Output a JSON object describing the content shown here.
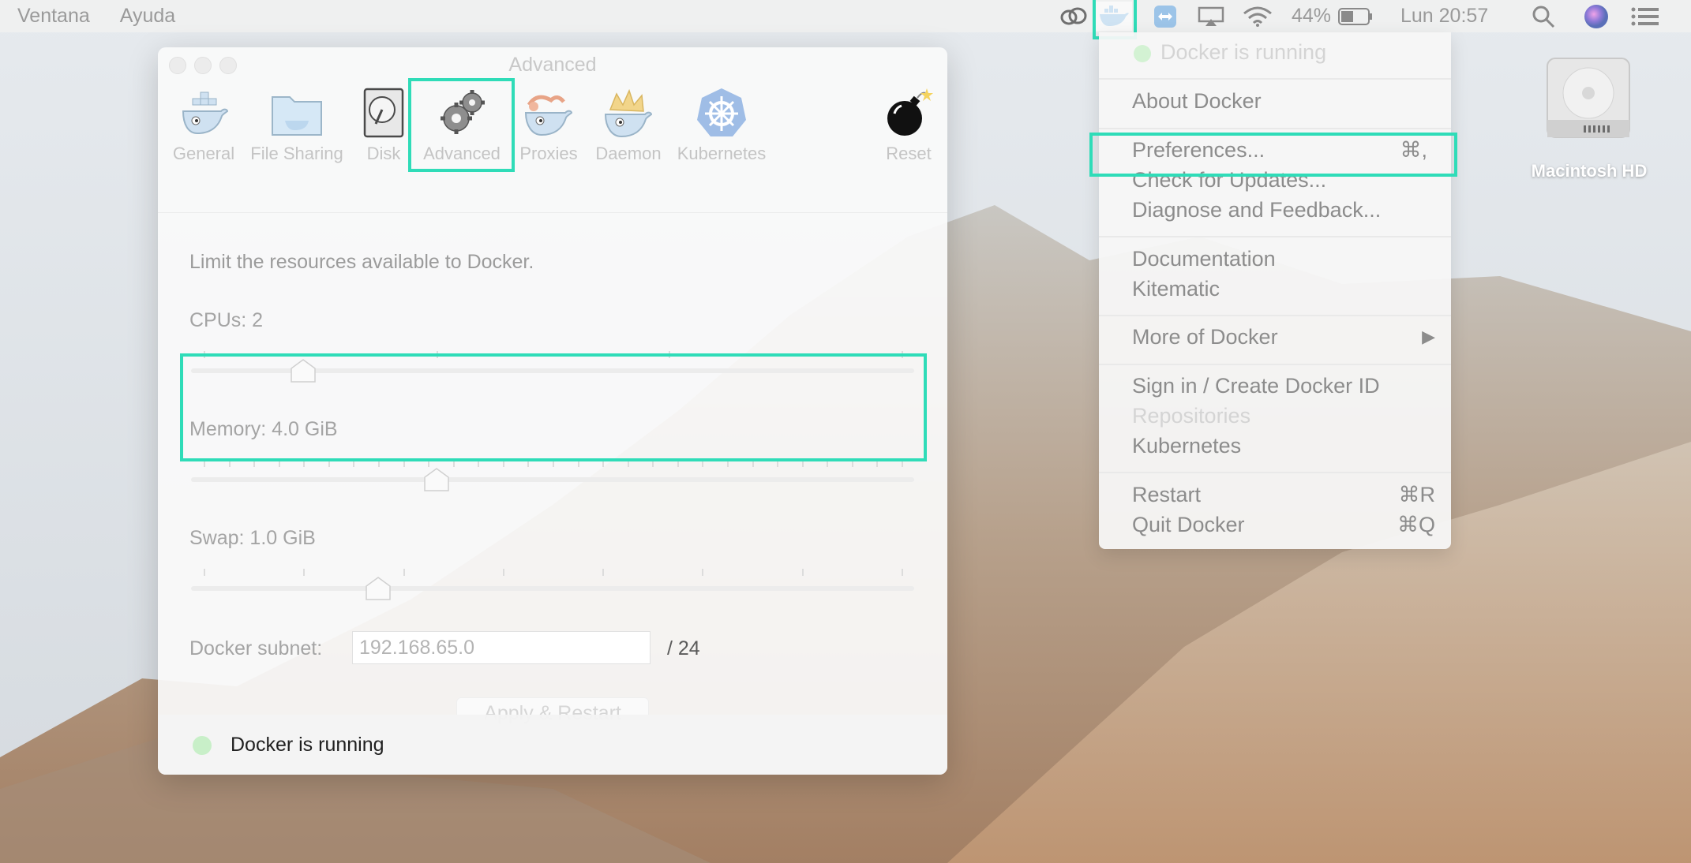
{
  "menubar": {
    "left_items": [
      "Ventana",
      "Ayuda"
    ],
    "battery_percent": "44%",
    "clock": "Lun 20:57",
    "icons": [
      "creative-cloud-icon",
      "docker-whale-icon",
      "teamviewer-icon",
      "airplay-icon",
      "wifi-icon",
      "battery-icon",
      "search-icon",
      "siri-icon",
      "notification-center-icon"
    ]
  },
  "prefs": {
    "window_title": "Advanced",
    "tabs": [
      {
        "label": "General",
        "icon": "docker-whale-icon"
      },
      {
        "label": "File Sharing",
        "icon": "folder-icon"
      },
      {
        "label": "Disk",
        "icon": "disk-icon"
      },
      {
        "label": "Advanced",
        "icon": "gears-icon"
      },
      {
        "label": "Proxies",
        "icon": "whale-proxies-icon"
      },
      {
        "label": "Daemon",
        "icon": "whale-daemon-icon"
      },
      {
        "label": "Kubernetes",
        "icon": "kubernetes-helm-icon"
      },
      {
        "label": "Reset",
        "icon": "bomb-icon"
      }
    ],
    "active_tab": "Advanced",
    "description": "Limit the resources available to Docker.",
    "cpus": {
      "label": "CPUs: 2",
      "value": 2,
      "min": 1,
      "max": 8
    },
    "memory": {
      "label": "Memory: 4.0 GiB",
      "value": 4.0,
      "min": 1,
      "max": 10
    },
    "swap": {
      "label": "Swap: 1.0 GiB",
      "value": 1.0,
      "min": 0,
      "max": 4
    },
    "subnet": {
      "label": "Docker subnet:",
      "value": "192.168.65.0",
      "mask": "/ 24"
    },
    "apply_button": "Apply & Restart",
    "status": "Docker is running",
    "status_color": "#c8efc8"
  },
  "dropdown": {
    "status": "Docker is running",
    "items": [
      {
        "label": "About Docker",
        "shortcut": ""
      },
      {
        "label": "Preferences...",
        "shortcut": "⌘,"
      },
      {
        "label": "Check for Updates...",
        "shortcut": ""
      },
      {
        "label": "Diagnose and Feedback...",
        "shortcut": ""
      },
      {
        "label": "Documentation",
        "shortcut": ""
      },
      {
        "label": "Kitematic",
        "shortcut": ""
      },
      {
        "label": "More of Docker",
        "shortcut": "▶"
      },
      {
        "label": "Sign in / Create Docker ID",
        "shortcut": ""
      },
      {
        "label": "Repositories",
        "shortcut": ""
      },
      {
        "label": "Kubernetes",
        "shortcut": ""
      },
      {
        "label": "Restart",
        "shortcut": "⌘R"
      },
      {
        "label": "Quit Docker",
        "shortcut": "⌘Q"
      }
    ]
  },
  "desktop": {
    "hd_label": "Macintosh HD"
  },
  "highlight_color": "#2fdcb8"
}
